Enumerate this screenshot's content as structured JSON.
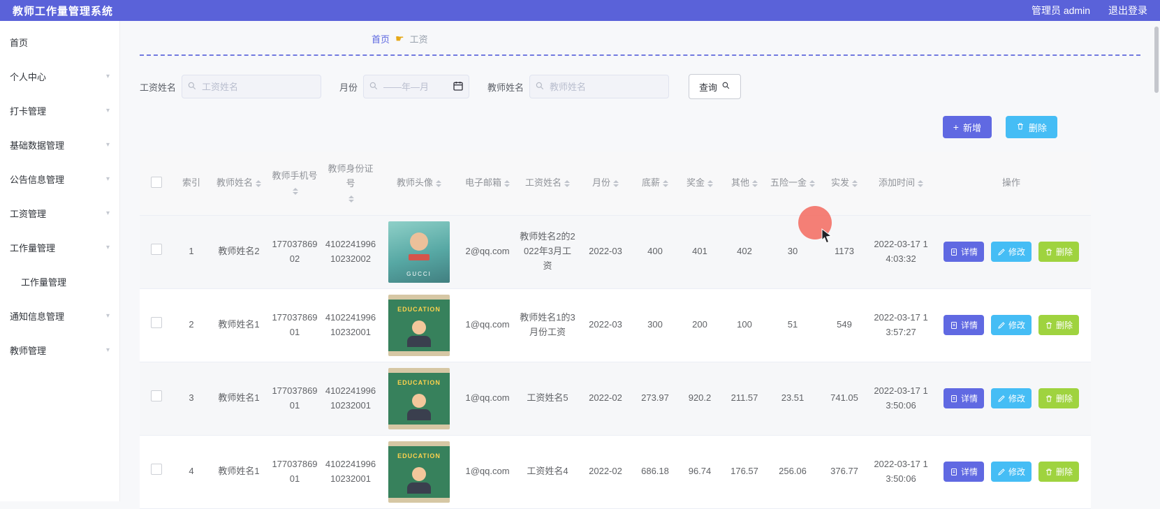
{
  "app": {
    "title": "教师工作量管理系统",
    "user": "管理员 admin",
    "logout": "退出登录"
  },
  "sidebar": {
    "items": [
      {
        "label": "首页",
        "children": false,
        "indent": 0
      },
      {
        "label": "个人中心",
        "children": true,
        "indent": 0
      },
      {
        "label": "打卡管理",
        "children": true,
        "indent": 0
      },
      {
        "label": "基础数据管理",
        "children": true,
        "indent": 0
      },
      {
        "label": "公告信息管理",
        "children": true,
        "indent": 0
      },
      {
        "label": "工资管理",
        "children": true,
        "indent": 0
      },
      {
        "label": "工作量管理",
        "children": true,
        "indent": 0
      },
      {
        "label": "工作量管理",
        "children": false,
        "indent": 1
      },
      {
        "label": "通知信息管理",
        "children": true,
        "indent": 0
      },
      {
        "label": "教师管理",
        "children": true,
        "indent": 0
      }
    ]
  },
  "breadcrumb": {
    "home": "首页",
    "current": "工资"
  },
  "filters": {
    "salary_name_label": "工资姓名",
    "salary_name_placeholder": "工资姓名",
    "month_label": "月份",
    "month_placeholder": "——年—月",
    "teacher_name_label": "教师姓名",
    "teacher_name_placeholder": "教师姓名",
    "search_button": "查询"
  },
  "toolbar": {
    "add_label": "新增",
    "delete_label": "删除"
  },
  "row_actions": {
    "detail": "详情",
    "edit": "修改",
    "delete": "删除"
  },
  "table": {
    "columns": [
      {
        "key": "checkbox",
        "label": "",
        "type": "checkbox",
        "sortable": false
      },
      {
        "key": "index",
        "label": "索引",
        "sortable": false
      },
      {
        "key": "teacher_name",
        "label": "教师姓名",
        "sortable": true
      },
      {
        "key": "phone",
        "label": "教师手机号",
        "sortable": true
      },
      {
        "key": "id_card",
        "label": "教师身份证号",
        "sortable": true
      },
      {
        "key": "avatar",
        "label": "教师头像",
        "sortable": true
      },
      {
        "key": "email",
        "label": "电子邮箱",
        "sortable": true
      },
      {
        "key": "salary_name",
        "label": "工资姓名",
        "sortable": true
      },
      {
        "key": "month",
        "label": "月份",
        "sortable": true
      },
      {
        "key": "base",
        "label": "底薪",
        "sortable": true
      },
      {
        "key": "bonus",
        "label": "奖金",
        "sortable": true
      },
      {
        "key": "other",
        "label": "其他",
        "sortable": true
      },
      {
        "key": "insurance",
        "label": "五险一金",
        "sortable": true
      },
      {
        "key": "net",
        "label": "实发",
        "sortable": true
      },
      {
        "key": "added",
        "label": "添加时间",
        "sortable": true
      },
      {
        "key": "actions",
        "label": "操作",
        "sortable": false
      }
    ],
    "rows": [
      {
        "index": "1",
        "teacher_name": "教师姓名2",
        "phone": "17703786902",
        "id_card": "410224199610232002",
        "avatar": {
          "type": "photo",
          "label": "GUCCI"
        },
        "email": "2@qq.com",
        "salary_name": "教师姓名2的2022年3月工资",
        "month": "2022-03",
        "base": "400",
        "bonus": "401",
        "other": "402",
        "insurance": "30",
        "net": "1173",
        "added": "2022-03-17 14:03:32"
      },
      {
        "index": "2",
        "teacher_name": "教师姓名1",
        "phone": "17703786901",
        "id_card": "410224199610232001",
        "avatar": {
          "type": "education",
          "label": "EDUCATION"
        },
        "email": "1@qq.com",
        "salary_name": "教师姓名1的3月份工资",
        "month": "2022-03",
        "base": "300",
        "bonus": "200",
        "other": "100",
        "insurance": "51",
        "net": "549",
        "added": "2022-03-17 13:57:27"
      },
      {
        "index": "3",
        "teacher_name": "教师姓名1",
        "phone": "17703786901",
        "id_card": "410224199610232001",
        "avatar": {
          "type": "education",
          "label": "EDUCATION"
        },
        "email": "1@qq.com",
        "salary_name": "工资姓名5",
        "month": "2022-02",
        "base": "273.97",
        "bonus": "920.2",
        "other": "211.57",
        "insurance": "23.51",
        "net": "741.05",
        "added": "2022-03-17 13:50:06"
      },
      {
        "index": "4",
        "teacher_name": "教师姓名1",
        "phone": "17703786901",
        "id_card": "410224199610232001",
        "avatar": {
          "type": "education",
          "label": "EDUCATION"
        },
        "email": "1@qq.com",
        "salary_name": "工资姓名4",
        "month": "2022-02",
        "base": "686.18",
        "bonus": "96.74",
        "other": "176.57",
        "insurance": "256.06",
        "net": "376.77",
        "added": "2022-03-17 13:50:06"
      }
    ]
  },
  "colors": {
    "primary": "#5a62d9",
    "cyan": "#45bdf5",
    "lime": "#9fd33f",
    "cursor": "#f4796f"
  }
}
